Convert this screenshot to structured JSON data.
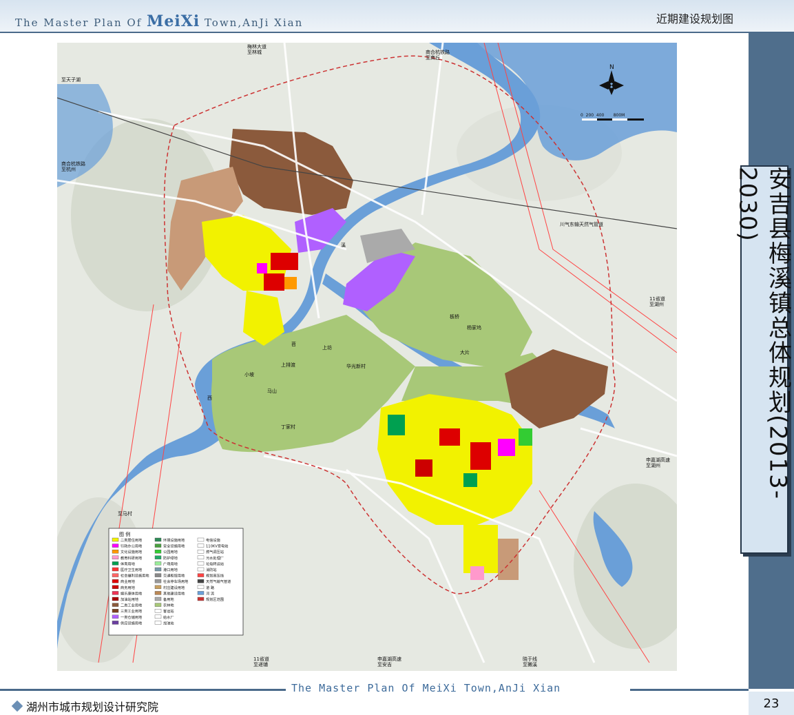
{
  "header": {
    "title_pre": "The Master Plan Of",
    "title_brand": "MeiXi",
    "title_post": "Town,AnJi Xian",
    "subtitle": "近期建设规划图"
  },
  "side_title": "安吉县梅溪镇总体规划(2013-2030)",
  "footer": {
    "english": "The Master Plan Of MeiXi Town,AnJi Xian",
    "org": "湖州市城市规划设计研究院",
    "page": "23"
  },
  "map": {
    "labels": {
      "north": "N",
      "scale": "0  200  400       800M",
      "tianzihu": "至天子湖",
      "hangzhou": "商合杭铁路\n至杭州",
      "meilin": "梅林大道\n至林城",
      "shanghe": "商合杭铁路\n至商丘",
      "lu11_hz": "11省道\n至湖州",
      "jiahu_hz": "申嘉湖高速\n至湖州",
      "gas": "川气东输天然气管道",
      "zhima": "至马村",
      "lu11_ac": "11省道\n至递铺",
      "jiahu_ac": "申嘉湖高速\n至安吉",
      "xiaoyu": "晓于线\n至獭溪",
      "shangfang": "上坊",
      "huaguang": "华光新村",
      "banqiao": "板桥",
      "yangjia": "杨家坞",
      "dapian": "大片",
      "xiaolv": "小坡",
      "shangpai": "上排渡",
      "mashan": "马山",
      "dingjia": "丁家村",
      "river_xi": "西",
      "river_tiao": "苕",
      "river_xi2": "溪"
    },
    "legend": {
      "title": "图  例",
      "items": [
        {
          "label": "二类居住用地",
          "color": "#f2f200"
        },
        {
          "label": "行政办公用地",
          "color": "#ff00ff"
        },
        {
          "label": "文化设施用地",
          "color": "#ff9900"
        },
        {
          "label": "教育科研用地",
          "color": "#ff99cc"
        },
        {
          "label": "体育用地",
          "color": "#00a050"
        },
        {
          "label": "医疗卫生用地",
          "color": "#ff3333"
        },
        {
          "label": "社会福利设施用地",
          "color": "#ff6666"
        },
        {
          "label": "商业用地",
          "color": "#dd0000"
        },
        {
          "label": "商务用地",
          "color": "#cc0000"
        },
        {
          "label": "娱乐康体用地",
          "color": "#ee3355"
        },
        {
          "label": "加油站用地",
          "color": "#aa0000"
        },
        {
          "label": "二类工业用地",
          "color": "#8b5a3c"
        },
        {
          "label": "三类工业用地",
          "color": "#7a4020"
        },
        {
          "label": "一类仓储用地",
          "color": "#b060ff"
        },
        {
          "label": "供应设施用地",
          "color": "#6b3fa0"
        },
        {
          "label": "环境设施用地",
          "color": "#2e8b57"
        },
        {
          "label": "安全设施用地",
          "color": "#4aa040"
        },
        {
          "label": "公园用地",
          "color": "#33cc33"
        },
        {
          "label": "防护绿地",
          "color": "#22aa66"
        },
        {
          "label": "广场用地",
          "color": "#99ee99"
        },
        {
          "label": "港口用地",
          "color": "#7799aa"
        },
        {
          "label": "交通枢纽用地",
          "color": "#888888"
        },
        {
          "label": "社会停车场用地",
          "color": "#999999"
        },
        {
          "label": "村庄建设用地",
          "color": "#c8a060"
        },
        {
          "label": "其他建设用地",
          "color": "#bb8855"
        },
        {
          "label": "备用地",
          "color": "#aaaaaa"
        },
        {
          "label": "农林地",
          "color": "#a8c878"
        },
        {
          "label": "客运站",
          "color": "#ffffff"
        },
        {
          "label": "给水厂",
          "color": "#ffffff"
        },
        {
          "label": "加油站",
          "color": "#ffffff"
        },
        {
          "label": "电信设施",
          "color": "#ffffff"
        },
        {
          "label": "110KV变电站",
          "color": "#ffffff"
        },
        {
          "label": "燃气调压站",
          "color": "#ffffff"
        },
        {
          "label": "污水处理厂",
          "color": "#ffffff"
        },
        {
          "label": "垃圾转运站",
          "color": "#ffffff"
        },
        {
          "label": "消防站",
          "color": "#ffffff"
        },
        {
          "label": "规划高压线",
          "color": "#ff4444"
        },
        {
          "label": "天然气输气管道",
          "color": "#444444"
        },
        {
          "label": "道  路",
          "color": "#ffffff"
        },
        {
          "label": "河  流",
          "color": "#6a9fd8"
        },
        {
          "label": "规划区范围",
          "color": "#cc3333"
        }
      ]
    },
    "colors": {
      "water": "#6a9fd8",
      "residential": "#f2f200",
      "industrial": "#8b5a3c",
      "agri": "#a8c878",
      "warehouse": "#b060ff",
      "commercial": "#dd0000",
      "green": "#33cc33",
      "village": "#c8a060"
    }
  }
}
